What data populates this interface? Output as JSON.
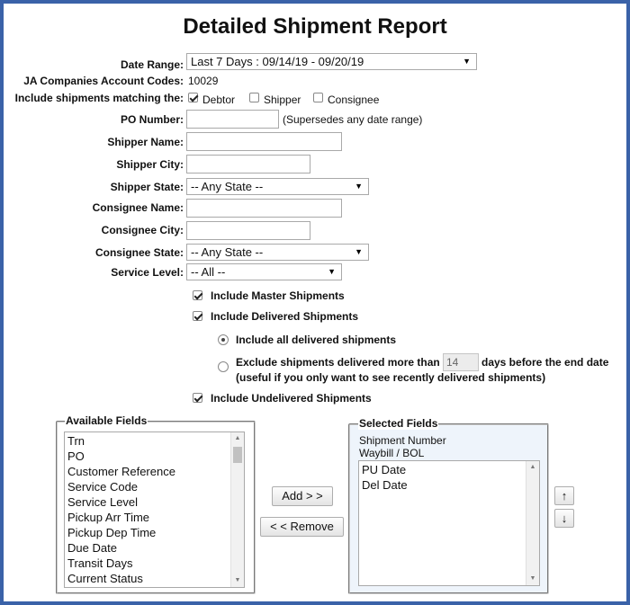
{
  "page": {
    "title": "Detailed Shipment Report"
  },
  "form": {
    "date_range": {
      "label": "Date Range:",
      "value": "Last 7 Days : 09/14/19 - 09/20/19"
    },
    "account_codes": {
      "label": "JA Companies Account Codes:",
      "value": "10029"
    },
    "matching": {
      "label": "Include shipments matching the:",
      "options": [
        {
          "label": "Debtor",
          "checked": true
        },
        {
          "label": "Shipper",
          "checked": false
        },
        {
          "label": "Consignee",
          "checked": false
        }
      ]
    },
    "po_number": {
      "label": "PO Number:",
      "value": "",
      "note": "(Supersedes any date range)"
    },
    "shipper_name": {
      "label": "Shipper Name:",
      "value": ""
    },
    "shipper_city": {
      "label": "Shipper City:",
      "value": ""
    },
    "shipper_state": {
      "label": "Shipper State:",
      "value": "-- Any State --"
    },
    "consignee_name": {
      "label": "Consignee Name:",
      "value": ""
    },
    "consignee_city": {
      "label": "Consignee City:",
      "value": ""
    },
    "consignee_state": {
      "label": "Consignee State:",
      "value": "-- Any State --"
    },
    "service_level": {
      "label": "Service Level:",
      "value": "-- All --"
    },
    "include_master": {
      "label": "Include Master Shipments",
      "checked": true
    },
    "include_delivered": {
      "label": "Include Delivered Shipments",
      "checked": true
    },
    "delivered_all": {
      "label": "Include all delivered shipments",
      "selected": true
    },
    "delivered_exclude": {
      "label_before": "Exclude shipments delivered more than",
      "days_value": "14",
      "label_after": "days before the end date",
      "note": "(useful if you only want to see recently delivered shipments)",
      "selected": false
    },
    "include_undelivered": {
      "label": "Include Undelivered Shipments",
      "checked": true
    }
  },
  "available_fields": {
    "legend": "Available Fields",
    "items": [
      "Trn",
      "PO",
      "Customer Reference",
      "Service Code",
      "Service Level",
      "Pickup Arr Time",
      "Pickup Dep Time",
      "Due Date",
      "Transit Days",
      "Current Status"
    ]
  },
  "buttons": {
    "add": "Add > >",
    "remove": "< < Remove",
    "up": "↑",
    "down": "↓"
  },
  "selected_fields": {
    "legend": "Selected Fields",
    "fixed": [
      "Shipment Number",
      "Waybill / BOL"
    ],
    "items": [
      "PU Date",
      "Del Date"
    ]
  }
}
